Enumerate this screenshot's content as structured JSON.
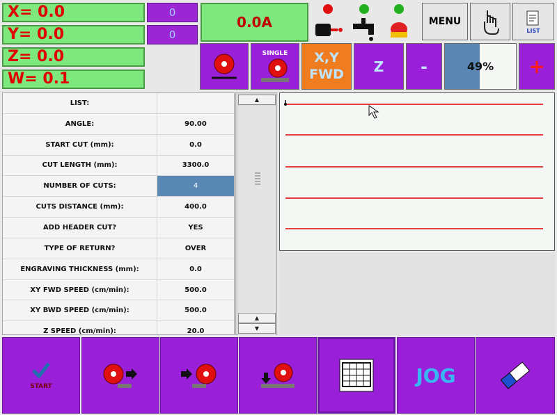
{
  "coords": {
    "x": "X= 0.0",
    "y": "Y= 0.0",
    "z": "Z= 0.0",
    "w": "W= 0.1"
  },
  "zero_badges": {
    "a": "0",
    "b": "0"
  },
  "current": "0.0A",
  "menu_label": "MENU",
  "list_label": "LIST",
  "toolbar": {
    "single_label": "SINGLE",
    "xy_fwd": "X,Y\nFWD",
    "z_label": "Z",
    "minus": "-",
    "plus": "+",
    "percent": "49%",
    "percent_value": 0.49
  },
  "table": [
    {
      "label": "LIST:",
      "value": ""
    },
    {
      "label": "ANGLE:",
      "value": "90.00"
    },
    {
      "label": "START CUT (mm):",
      "value": "0.0"
    },
    {
      "label": "CUT LENGTH (mm):",
      "value": "3300.0"
    },
    {
      "label": "NUMBER OF CUTS:",
      "value": "4",
      "selected": true
    },
    {
      "label": "CUTS DISTANCE (mm):",
      "value": "400.0"
    },
    {
      "label": "ADD HEADER CUT?",
      "value": "YES"
    },
    {
      "label": "TYPE OF RETURN?",
      "value": "OVER"
    },
    {
      "label": "ENGRAVING THICKNESS (mm):",
      "value": "0.0"
    },
    {
      "label": "XY FWD SPEED (cm/min):",
      "value": "500.0"
    },
    {
      "label": "XY BWD SPEED (cm/min):",
      "value": "500.0"
    },
    {
      "label": "Z SPEED (cm/min):",
      "value": "20.0"
    }
  ],
  "bottom": {
    "start": "START",
    "jog": "JOG"
  },
  "colors": {
    "accent": "#9a1fd8",
    "green": "#7ee87e",
    "orange": "#f07c20",
    "red": "#e00000"
  }
}
